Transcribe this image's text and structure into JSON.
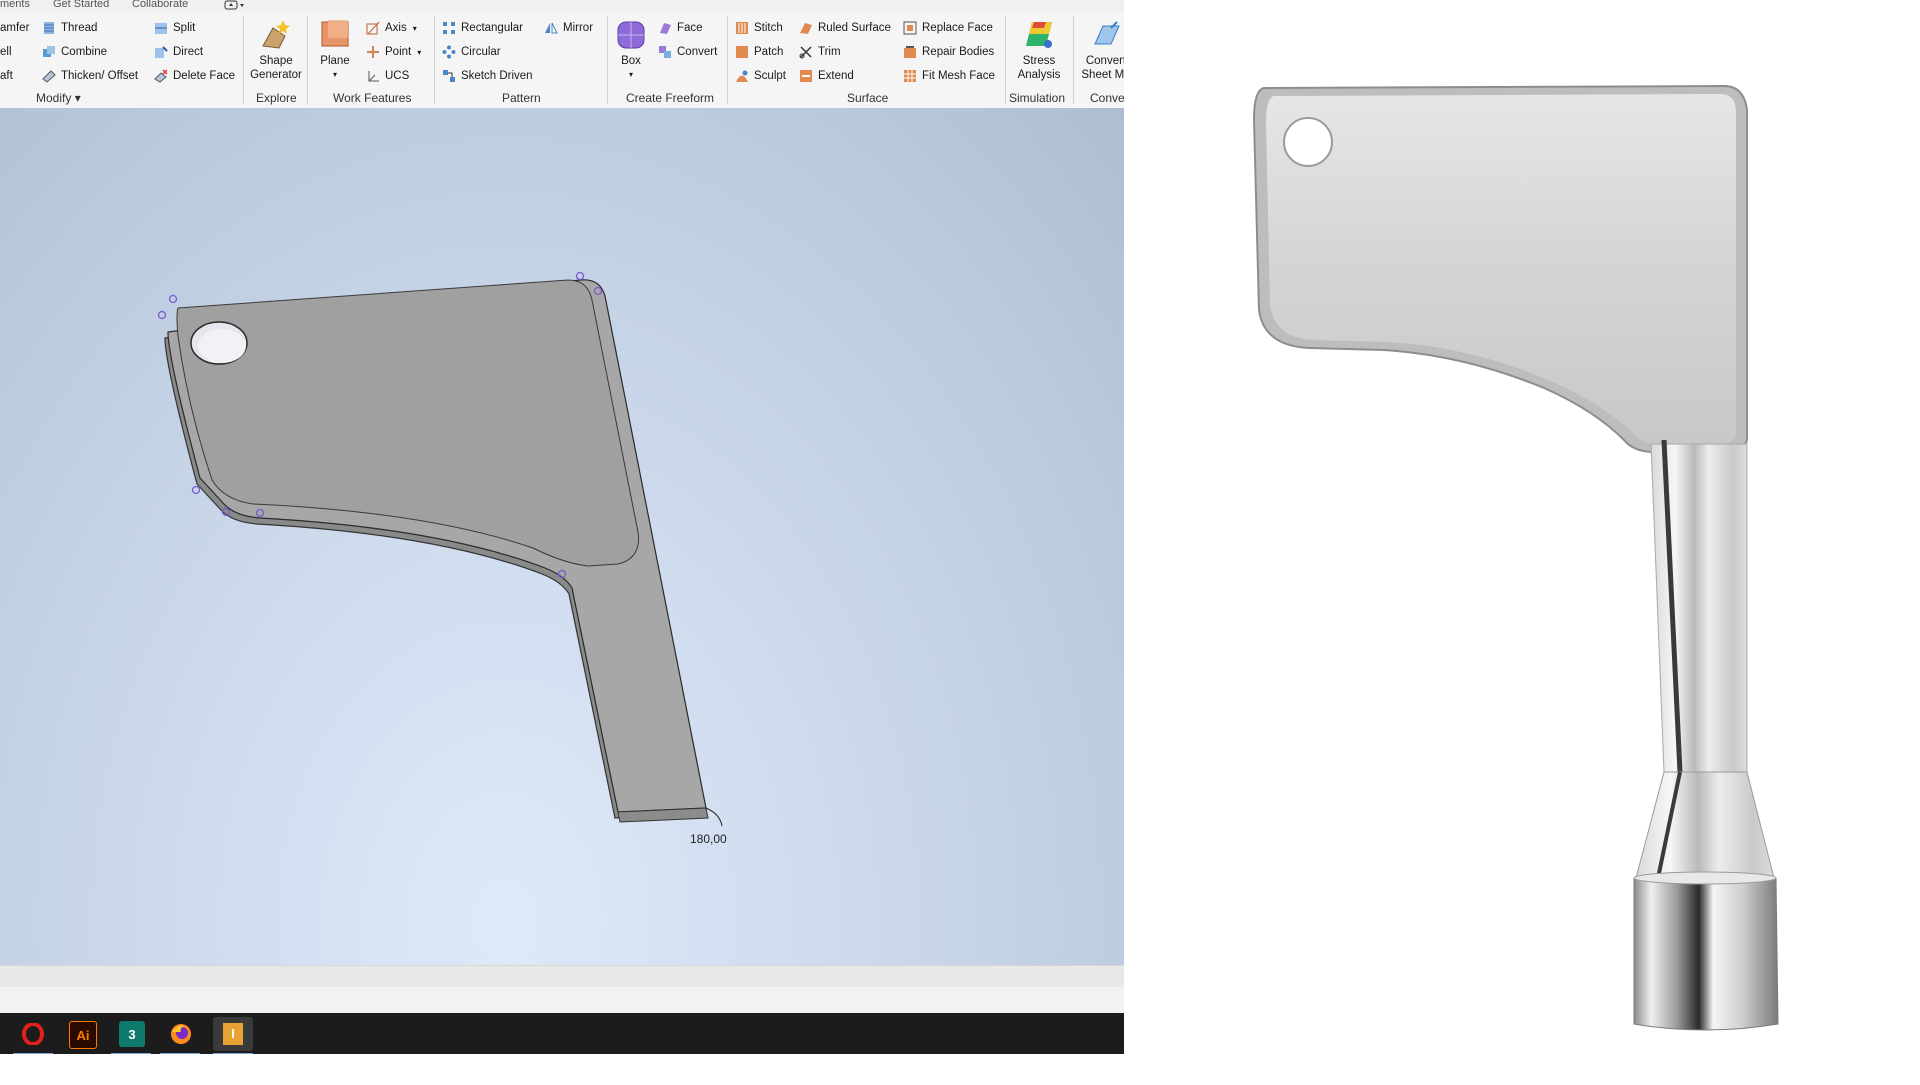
{
  "tabs": [
    "ments",
    "Get Started",
    "Collaborate"
  ],
  "ribbon": {
    "modify": {
      "items": [
        "amfer",
        "ell",
        "aft"
      ],
      "col2": [
        "Thread",
        "Combine",
        "Thicken/ Offset"
      ],
      "col3": [
        "Split",
        "Direct",
        "Delete Face"
      ],
      "label": "Modify"
    },
    "explore": {
      "button": [
        "Shape",
        "Generator"
      ],
      "label": "Explore"
    },
    "work_features": {
      "plane": "Plane",
      "items": [
        "Axis",
        "Point",
        "UCS"
      ],
      "label": "Work Features"
    },
    "pattern": {
      "items": [
        "Rectangular",
        "Circular",
        "Sketch Driven"
      ],
      "mirror": "Mirror",
      "label": "Pattern"
    },
    "create_freeform": {
      "box": "Box",
      "items": [
        "Face",
        "Convert"
      ],
      "label": "Create Freeform"
    },
    "surface": {
      "col1": [
        "Stitch",
        "Patch",
        "Sculpt"
      ],
      "col2": [
        "Ruled Surface",
        "Trim",
        "Extend"
      ],
      "col3": [
        "Replace Face",
        "Repair Bodies",
        "Fit Mesh Face"
      ],
      "label": "Surface"
    },
    "simulation": {
      "button": [
        "Stress",
        "Analysis"
      ],
      "label": "Simulation"
    },
    "convert": {
      "button": [
        "Convert",
        "Sheet Me"
      ],
      "label": "Conve"
    }
  },
  "viewport": {
    "dimension": "180,00"
  },
  "taskbar": {
    "apps": [
      "opera-icon",
      "illustrator-icon",
      "3d-app-icon",
      "firefox-icon",
      "inventor-icon"
    ],
    "illustrator_text": "Ai",
    "app3_text": "3",
    "inventor_text": "I"
  }
}
